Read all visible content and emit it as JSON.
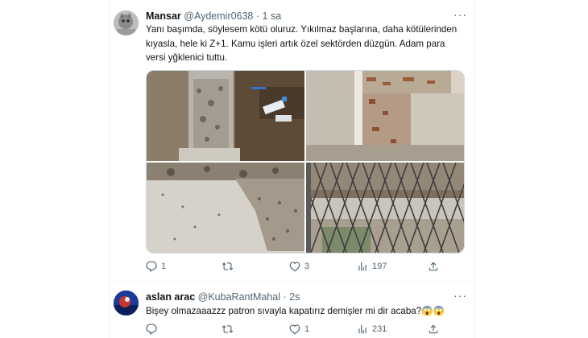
{
  "tweets": [
    {
      "name": "Mansar",
      "handle": "@Aydemir0638",
      "separator": "·",
      "time": "1 sa",
      "more": "···",
      "text": "Yanı başımda, söylesem kötü oluruz. Yıkılmaz başlarına, daha kötülerinden\nkıyasla, hele ki Z+1. Kamu işleri artık özel sektörden düzgün. Adam para\nversi yğklenici tuttu.",
      "media_count": 4,
      "reply_count": "1",
      "retweet_count": "",
      "like_count": "3",
      "view_count": "197"
    },
    {
      "name": "aslan arac",
      "handle": "@KubaRantMahal",
      "separator": "·",
      "time": "2s",
      "more": "···",
      "text": "Bişey olmazaaazzz patron sıvayla kapatırız demişler mi dir acaba?😱😱",
      "reply_count": "",
      "retweet_count": "",
      "like_count": "1",
      "view_count": "231"
    }
  ],
  "colors": {
    "text": "#0f1419",
    "secondary": "#536471",
    "border": "#eff3f4",
    "media_border": "#cfd9de"
  },
  "icons": [
    "reply-icon",
    "retweet-icon",
    "like-icon",
    "views-icon",
    "share-icon",
    "more-icon"
  ]
}
